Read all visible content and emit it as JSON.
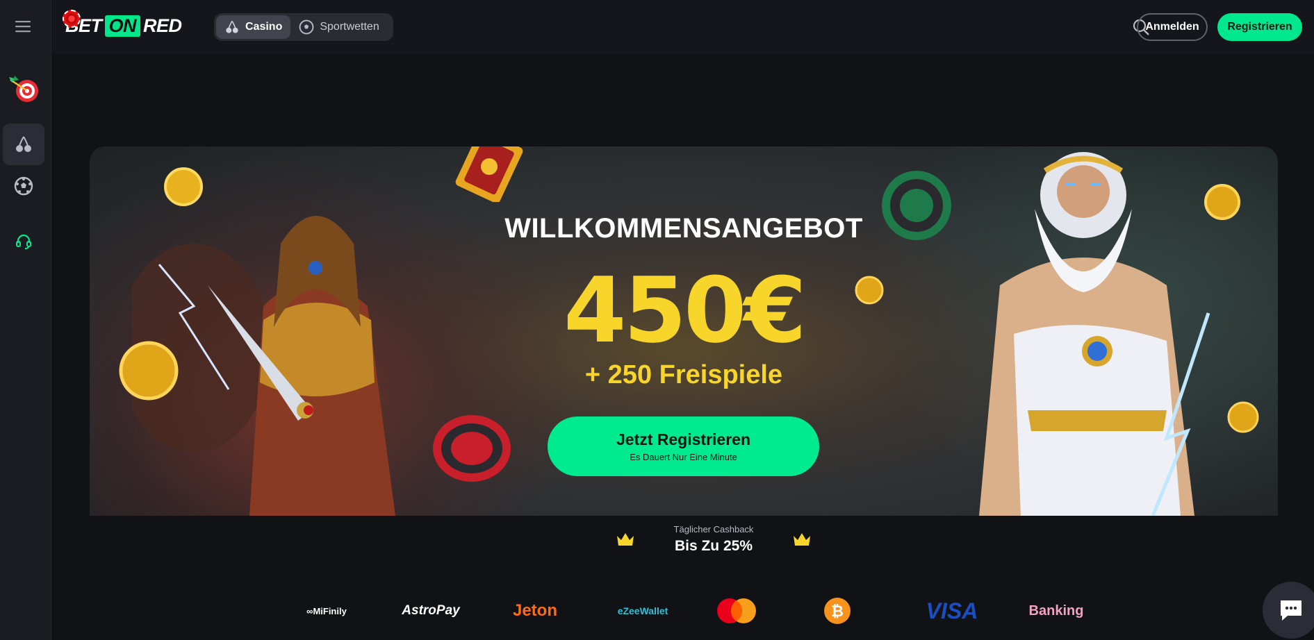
{
  "colors": {
    "accent": "#00e88f",
    "gold": "#f7d52a",
    "background": "#111216"
  },
  "header": {
    "logo": {
      "part1": "BET",
      "part2": "ON",
      "part3": "RED"
    },
    "tabs": [
      {
        "label": "Casino",
        "icon": "cherry-icon",
        "active": true
      },
      {
        "label": "Sportwetten",
        "icon": "soccer-ball-icon",
        "active": false
      }
    ],
    "login_label": "Anmelden",
    "register_label": "Registrieren"
  },
  "sidebar": {
    "items": [
      {
        "icon": "menu-icon"
      },
      {
        "icon": "dart-target-icon"
      },
      {
        "icon": "cherry-icon",
        "active": true
      },
      {
        "icon": "soccer-ball-icon"
      },
      {
        "icon": "headset-icon"
      }
    ]
  },
  "hero": {
    "title": "WILLKOMMENSANGEBOT",
    "amount": "450€",
    "spins": "+ 250 Freispiele",
    "cta_label": "Jetzt Registrieren",
    "cta_sub": "Es Dauert Nur Eine Minute"
  },
  "cashback": {
    "label": "Täglicher Cashback",
    "value": "Bis Zu 25%"
  },
  "payments": [
    "MiFinily",
    "AstroPay",
    "Jeton",
    "eZeeWallet",
    "Mastercard",
    "Bitcoin",
    "VISA",
    "Banking"
  ]
}
